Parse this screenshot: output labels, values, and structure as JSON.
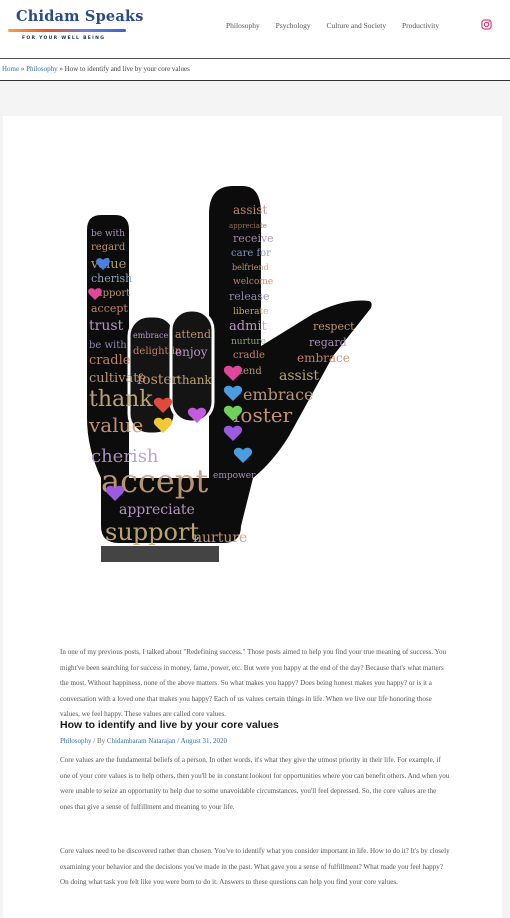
{
  "site": {
    "logo_title": "Chidam Speaks",
    "logo_tagline": "FOR YOUR WELL BEING",
    "brand_color": "#2a4a88",
    "link_color": "#3a6fb0"
  },
  "nav": {
    "items": [
      "Philosophy",
      "Psychology",
      "Culture and Society",
      "Productivity"
    ],
    "social_icon": "instagram-icon"
  },
  "breadcrumb": {
    "home": "Home",
    "sep1": "»",
    "category": "Philosophy",
    "sep2": "»",
    "current": "How to identify and live by your core values"
  },
  "hero_image": {
    "words": [
      "assist",
      "appreciate",
      "receive",
      "care for",
      "welcome",
      "release",
      "admit",
      "nurture",
      "attend",
      "respect",
      "regard",
      "embrace",
      "assist",
      "foster",
      "be with",
      "value",
      "cherish",
      "support",
      "accept",
      "trust",
      "be with",
      "cradle",
      "cultivate",
      "thank",
      "value",
      "cherish",
      "delight in",
      "embrace",
      "enjoy",
      "foster",
      "thank",
      "accept",
      "appreciate",
      "support",
      "nurture",
      "treasure",
      "empower"
    ]
  },
  "post": {
    "title": "How to identify and live by your core values",
    "category": "Philosophy",
    "by": "/ By",
    "author": "Chidambaram Natarajan",
    "date_sep": "/",
    "date": "August 31, 2020",
    "paragraphs": [
      "In one of my previous posts, I talked about \"Redefining success.\" Those posts aimed to help you find your true meaning of success. You might've been searching for success in money, fame, power, etc. But were you happy at the end of the day? Because that's what matters the most. Without happiness, none of the above matters. So what makes you happy? Does being honest makes you happy? or is it a conversation with a loved one that makes you happy? Each of us values certain things in life. When we live our life honoring those values, we feel happy. These values are called core values.",
      "Core values are the fundamental beliefs of a person. In other words, it's what they give the utmost priority in their life. For example, if one of your core values is to help others, then you'll be in constant lookout for opportunities where you can benefit others. And when you were unable to seize an opportunity to help due to some unavoidable circumstances, you'll feel depressed. So, the core values are the ones that give a sense of fulfillment and meaning to your life.",
      "Core values need to be discovered rather than chosen. You've to identify what you consider important in life. How to do it? It's by closely examining your behavior and the decisions you've made in the past. What gave you a sense of fulfillment? What made you feel happy? On doing what task you felt like you were born to do it. Answers to these questions can help you find your core values."
    ]
  }
}
